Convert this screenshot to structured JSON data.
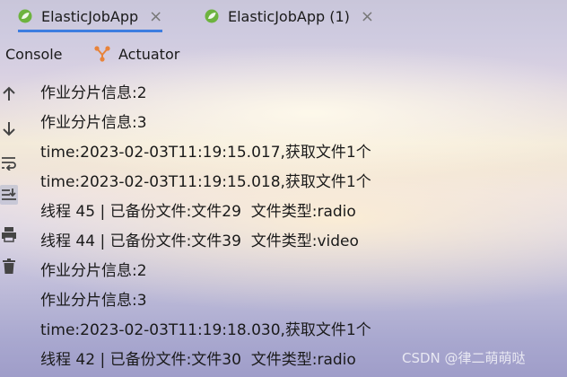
{
  "tabs": [
    {
      "label": "ElasticJobApp",
      "active": true,
      "icon": "spring-leaf-icon"
    },
    {
      "label": "ElasticJobApp (1)",
      "active": false,
      "icon": "spring-leaf-icon"
    }
  ],
  "close_glyph": "×",
  "subtabs": [
    {
      "label": "Console",
      "icon": ""
    },
    {
      "label": "Actuator",
      "icon": "actuator-icon"
    }
  ],
  "gutter_icons": [
    "scroll-up-icon",
    "scroll-down-icon",
    "soft-wrap-icon",
    "scroll-to-end-icon",
    "print-icon",
    "clear-icon"
  ],
  "console_lines": [
    "作业分片信息:2",
    "作业分片信息:3",
    "time:2023-02-03T11:19:15.017,获取文件1个",
    "time:2023-02-03T11:19:15.018,获取文件1个",
    "线程 45 | 已备份文件:文件29  文件类型:radio",
    "线程 44 | 已备份文件:文件39  文件类型:video",
    "作业分片信息:2",
    "作业分片信息:3",
    "time:2023-02-03T11:19:18.030,获取文件1个",
    "线程 42 | 已备份文件:文件30  文件类型:radio"
  ],
  "watermark": "CSDN @律二萌萌哒",
  "colors": {
    "accent": "#3d7de0",
    "spring_green": "#6db33f",
    "actuator_orange": "#e8833a"
  }
}
